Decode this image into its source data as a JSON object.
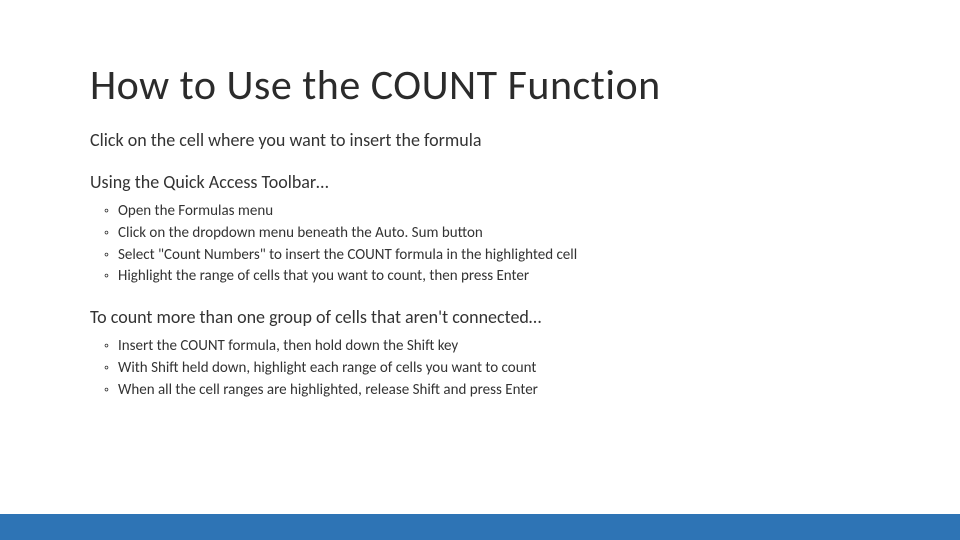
{
  "title": "How to Use the COUNT Function",
  "intro": "Click on the cell where you want to insert the formula",
  "section1": {
    "heading": "Using the Quick Access Toolbar…",
    "items": [
      "Open the Formulas menu",
      "Click on the dropdown menu beneath the Auto. Sum button",
      "Select \"Count Numbers\" to insert the COUNT formula in the highlighted cell",
      "Highlight the range of cells that you want to count, then press Enter"
    ]
  },
  "section2": {
    "heading": "To count more than one group of cells that aren't connected…",
    "items": [
      "Insert the COUNT formula, then hold down the Shift key",
      "With Shift held down, highlight each range of cells you want to count",
      "When all the cell ranges are highlighted, release Shift and press Enter"
    ]
  }
}
